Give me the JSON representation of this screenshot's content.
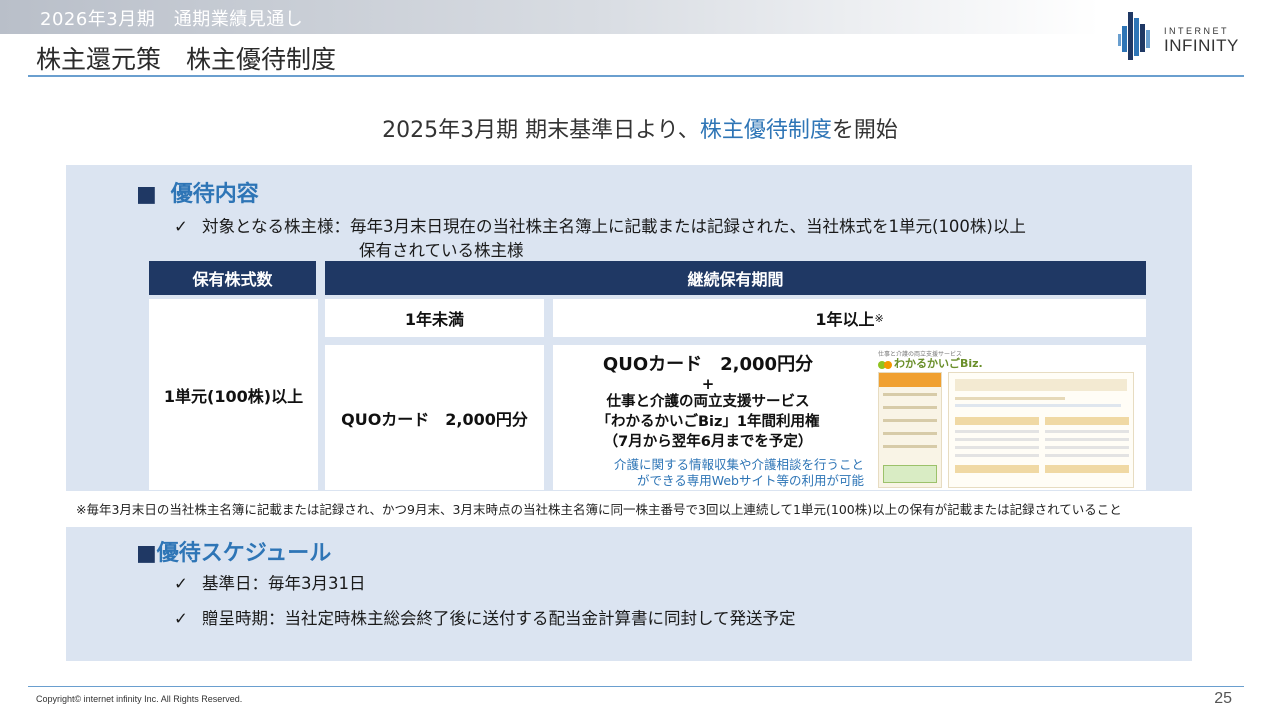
{
  "header": {
    "period_label": "2026年3月期　通期業績見通し",
    "title": "株主還元策　株主優待制度",
    "logo_line1": "INTERNET",
    "logo_line2": "INFINITY"
  },
  "intro": {
    "pre": "2025年3月期 期末基準日より、",
    "highlight": "株主優待制度",
    "post": "を開始"
  },
  "benefit": {
    "square": "■",
    "heading": "優待内容",
    "check_mark": "✓",
    "target_line1": "対象となる株主様：毎年3月末日現在の当社株主名簿上に記載または記録された、当社株式を1単元(100株)以上",
    "target_line2": "保有されている株主様",
    "table": {
      "col1_header": "保有株式数",
      "col2_header": "継続保有期間",
      "holding": "1単元(100株)以上",
      "period_short": "1年未満",
      "period_long": "1年以上",
      "period_long_mark": "※",
      "reward_short": "QUOカード　2,000円分",
      "reward_long_line1": "QUOカード　2,000円分",
      "reward_long_plus": "+",
      "reward_long_line2": "仕事と介護の両立支援サービス",
      "reward_long_line3": "「わかるかいごBiz」1年間利用権",
      "reward_long_line4": "（7月から翌年6月までを予定）",
      "note_line1": "介護に関する情報収集や介護相談を行うこと",
      "note_line2": "ができる専用Webサイト等の利用が可能",
      "screenshot": {
        "tagline": "仕事と介護の両立支援サービス",
        "logo": "わかるかいごBiz."
      }
    },
    "footnote": "※毎年3月末日の当社株主名簿に記載または記録され、かつ9月末、3月末時点の当社株主名簿に同一株主番号で3回以上連続して1単元(100株)以上の保有が記載または記録されていること"
  },
  "schedule": {
    "square": "■",
    "heading": "優待スケジュール",
    "check_mark": "✓",
    "items": [
      "基準日：毎年3月31日",
      "贈呈時期：当社定時株主総会終了後に送付する配当金計算書に同封して発送予定"
    ]
  },
  "footer": {
    "copyright": "Copyright© internet infinity Inc. All Rights Reserved.",
    "page": "25"
  },
  "colors": {
    "navy": "#1f3864",
    "accent_blue": "#2e75b6",
    "panel_bg": "#dbe4f1",
    "rule": "#6a9fcf"
  }
}
